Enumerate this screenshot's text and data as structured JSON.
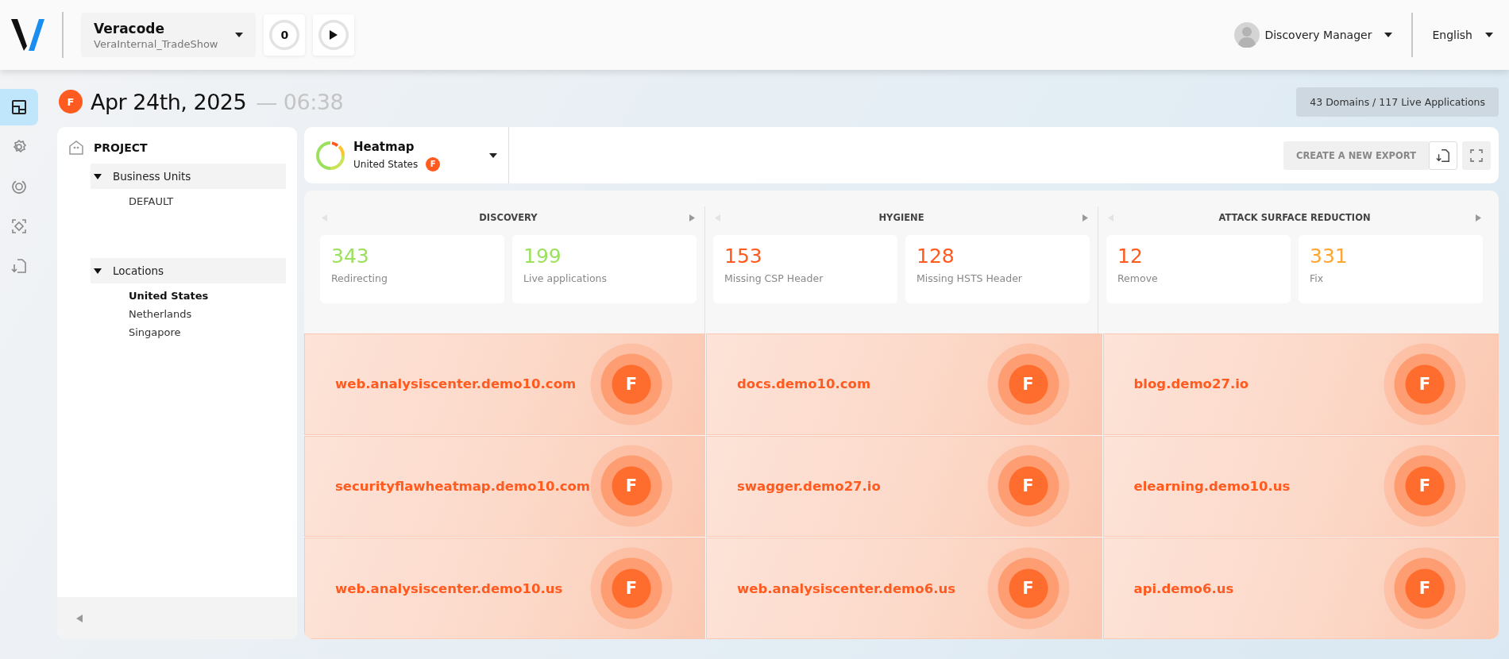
{
  "header": {
    "org_name": "Veracode",
    "project": "VeraInternal_TradeShow",
    "counter": "0",
    "user": "Discovery Manager",
    "language": "English"
  },
  "nav": [
    {
      "kind": "dashboard",
      "selected": true
    },
    {
      "kind": "settings",
      "selected": false
    },
    {
      "kind": "target",
      "selected": false
    },
    {
      "kind": "scan",
      "selected": false
    },
    {
      "kind": "export",
      "selected": false
    }
  ],
  "date_row": {
    "grade": "F",
    "date": "Apr 24th, 2025",
    "separator": "—",
    "time": "06:38",
    "summary": "43 Domains / 117 Live Applications"
  },
  "tree": {
    "title": "PROJECT",
    "groups": [
      {
        "label": "Business Units",
        "expanded": true,
        "children": [
          {
            "label": "DEFAULT",
            "selected": false
          }
        ]
      },
      {
        "label": "Locations",
        "expanded": true,
        "children": [
          {
            "label": "United States",
            "selected": true
          },
          {
            "label": "Netherlands",
            "selected": false
          },
          {
            "label": "Singapore",
            "selected": false
          }
        ]
      }
    ]
  },
  "heatmap": {
    "title": "Heatmap",
    "location": "United States",
    "grade": "F",
    "export_button": "CREATE A NEW EXPORT"
  },
  "metric_groups": [
    {
      "title": "DISCOVERY",
      "metrics": [
        {
          "value": "343",
          "label": "Redirecting",
          "color": "#9be15d"
        },
        {
          "value": "199",
          "label": "Live applications",
          "color": "#9be15d"
        }
      ]
    },
    {
      "title": "HYGIENE",
      "metrics": [
        {
          "value": "153",
          "label": "Missing CSP Header",
          "color": "#ff5a1f"
        },
        {
          "value": "128",
          "label": "Missing HSTS Header",
          "color": "#ff5a1f"
        }
      ]
    },
    {
      "title": "ATTACK SURFACE REDUCTION",
      "metrics": [
        {
          "value": "12",
          "label": "Remove",
          "color": "#ff5a1f"
        },
        {
          "value": "331",
          "label": "Fix",
          "color": "#ffa530"
        }
      ]
    }
  ],
  "tiles": [
    {
      "domain": "web.analysiscenter.demo10.com",
      "grade": "F"
    },
    {
      "domain": "docs.demo10.com",
      "grade": "F"
    },
    {
      "domain": "blog.demo27.io",
      "grade": "F"
    },
    {
      "domain": "securityflawheatmap.demo10.com",
      "grade": "F"
    },
    {
      "domain": "swagger.demo27.io",
      "grade": "F"
    },
    {
      "domain": "elearning.demo10.us",
      "grade": "F"
    },
    {
      "domain": "web.analysiscenter.demo10.us",
      "grade": "F"
    },
    {
      "domain": "web.analysiscenter.demo6.us",
      "grade": "F"
    },
    {
      "domain": "api.demo6.us",
      "grade": "F"
    }
  ]
}
